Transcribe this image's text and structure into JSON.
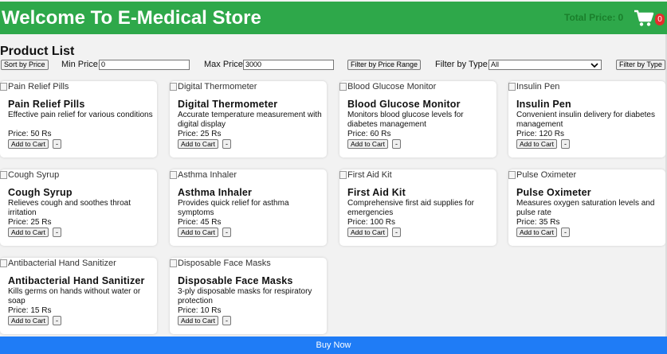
{
  "header": {
    "title": "Welcome To E-Medical Store",
    "total_label": "Total Price:",
    "total_value": "0",
    "cart_count": "0",
    "colors": {
      "bar": "#2ea84a",
      "badge": "#e52d2d"
    },
    "cart_icon": "shopping-cart-icon"
  },
  "main": {
    "list_title": "Product List"
  },
  "filters": {
    "sort_label": "Sort by Price",
    "min_label": "Min Price:",
    "min_value": "0",
    "max_label": "Max Price:",
    "max_value": "3000",
    "filter_price_label": "Filter by Price Range",
    "type_label": "Filter by Type:",
    "type_selected": "All",
    "filter_type_label": "Filter by Type"
  },
  "products": [
    {
      "img_alt": "Pain Relief Pills",
      "name": "Pain Relief Pills",
      "desc": "Effective pain relief for various conditions",
      "price": "Price: 50 Rs"
    },
    {
      "img_alt": "Digital Thermometer",
      "name": "Digital Thermometer",
      "desc": "Accurate temperature measurement with digital display",
      "price": "Price: 25 Rs"
    },
    {
      "img_alt": "Blood Glucose Monitor",
      "name": "Blood Glucose Monitor",
      "desc": "Monitors blood glucose levels for diabetes management",
      "price": "Price: 60 Rs"
    },
    {
      "img_alt": "Insulin Pen",
      "name": "Insulin Pen",
      "desc": "Convenient insulin delivery for diabetes management",
      "price": "Price: 120 Rs"
    },
    {
      "img_alt": "Cough Syrup",
      "name": "Cough Syrup",
      "desc": "Relieves cough and soothes throat irritation",
      "price": "Price: 25 Rs"
    },
    {
      "img_alt": "Asthma Inhaler",
      "name": "Asthma Inhaler",
      "desc": "Provides quick relief for asthma symptoms",
      "price": "Price: 45 Rs"
    },
    {
      "img_alt": "First Aid Kit",
      "name": "First Aid Kit",
      "desc": "Comprehensive first aid supplies for emergencies",
      "price": "Price: 100 Rs"
    },
    {
      "img_alt": "Pulse Oximeter",
      "name": "Pulse Oximeter",
      "desc": "Measures oxygen saturation levels and pulse rate",
      "price": "Price: 35 Rs"
    },
    {
      "img_alt": "Antibacterial Hand Sanitizer",
      "name": "Antibacterial Hand Sanitizer",
      "desc": "Kills germs on hands without water or soap",
      "price": "Price: 15 Rs"
    },
    {
      "img_alt": "Disposable Face Masks",
      "name": "Disposable Face Masks",
      "desc": "3-ply disposable masks for respiratory protection",
      "price": "Price: 10 Rs"
    }
  ],
  "card_buttons": {
    "add_label": "Add to Cart",
    "remove_label": "-"
  },
  "footer": {
    "buy_label": "Buy Now",
    "color": "#1f7cf6"
  }
}
